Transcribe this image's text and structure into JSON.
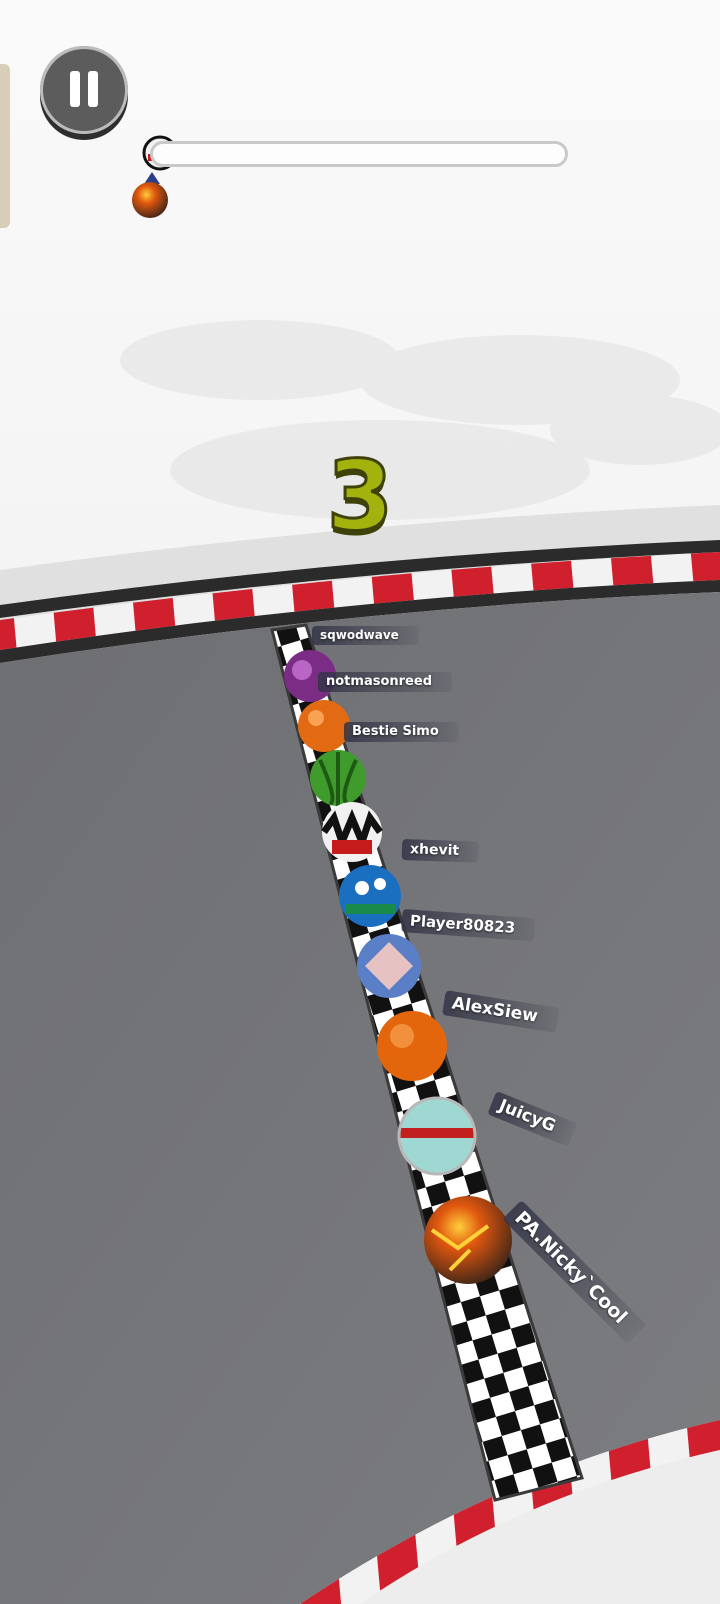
{
  "hud": {
    "pause_icon": "pause-icon",
    "progress": 0.0
  },
  "countdown": {
    "value": "3",
    "color": "#a3b20c"
  },
  "racers": [
    {
      "name": "sqwodwave"
    },
    {
      "name": "notmasonreed"
    },
    {
      "name": "Bestie Simo"
    },
    {
      "name": "xhevit"
    },
    {
      "name": "Player80823"
    },
    {
      "name": "AlexSiew"
    },
    {
      "name": "JuicyG"
    },
    {
      "name": "PA.Nicky`Cool"
    }
  ],
  "colors": {
    "track": "#707174",
    "kerb_red": "#d0202e",
    "kerb_white": "#f2f2f2",
    "sky": "#f3f3f3"
  }
}
